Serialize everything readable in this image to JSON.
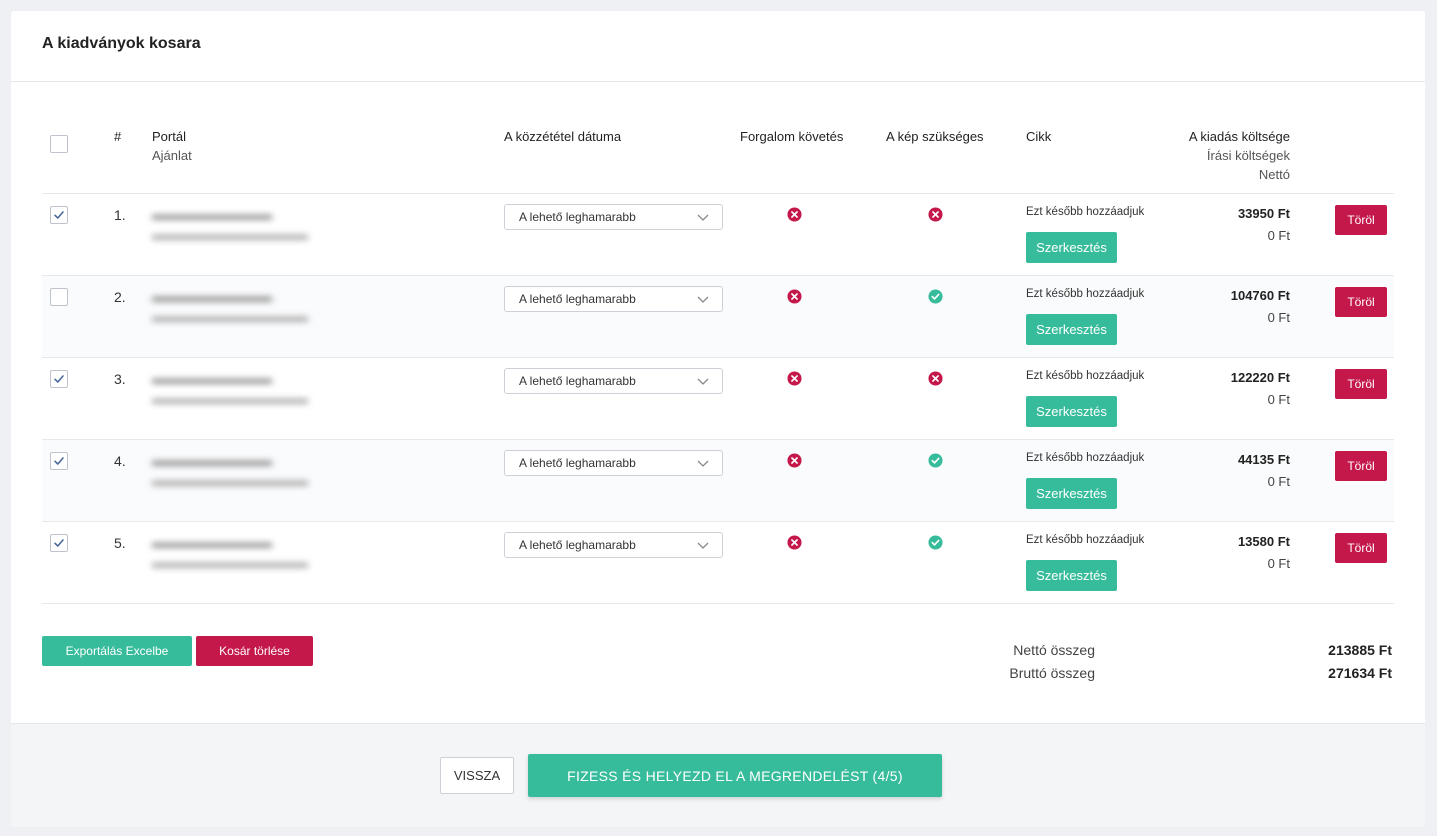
{
  "card": {
    "title": "A kiadványok kosara"
  },
  "table": {
    "headers": {
      "index": "#",
      "portal": "Portál",
      "portal_sub": "Ajánlat",
      "date": "A közzététel dátuma",
      "tracking": "Forgalom követés",
      "image": "A kép szükséges",
      "article": "Cikk",
      "cost": "A kiadás költsége",
      "cost_sub1": "Írási költségek",
      "cost_sub2": "Nettó"
    },
    "rows": [
      {
        "checked": true,
        "num": "1.",
        "date": "A lehető leghamarabb",
        "tracking": "no",
        "image": "no",
        "article_note": "Ezt később hozzáadjuk",
        "edit_label": "Szerkesztés",
        "price": "33950 Ft",
        "writing_cost": "0 Ft",
        "delete_label": "Töröl"
      },
      {
        "checked": false,
        "num": "2.",
        "date": "A lehető leghamarabb",
        "tracking": "no",
        "image": "yes",
        "article_note": "Ezt később hozzáadjuk",
        "edit_label": "Szerkesztés",
        "price": "104760 Ft",
        "writing_cost": "0 Ft",
        "delete_label": "Töröl"
      },
      {
        "checked": true,
        "num": "3.",
        "date": "A lehető leghamarabb",
        "tracking": "no",
        "image": "no",
        "article_note": "Ezt később hozzáadjuk",
        "edit_label": "Szerkesztés",
        "price": "122220 Ft",
        "writing_cost": "0 Ft",
        "delete_label": "Töröl"
      },
      {
        "checked": true,
        "num": "4.",
        "date": "A lehető leghamarabb",
        "tracking": "no",
        "image": "yes",
        "article_note": "Ezt később hozzáadjuk",
        "edit_label": "Szerkesztés",
        "price": "44135 Ft",
        "writing_cost": "0 Ft",
        "delete_label": "Töröl"
      },
      {
        "checked": true,
        "num": "5.",
        "date": "A lehető leghamarabb",
        "tracking": "no",
        "image": "yes",
        "article_note": "Ezt később hozzáadjuk",
        "edit_label": "Szerkesztés",
        "price": "13580 Ft",
        "writing_cost": "0 Ft",
        "delete_label": "Töröl"
      }
    ]
  },
  "actions": {
    "export_label": "Exportálás Excelbe",
    "clear_label": "Kosár törlése"
  },
  "totals": {
    "net_label": "Nettó összeg",
    "net_value": "213885 Ft",
    "gross_label": "Bruttó összeg",
    "gross_value": "271634 Ft"
  },
  "footer": {
    "back_label": "VISSZA",
    "pay_label": "FIZESS ÉS HELYEZD EL A MEGRENDELÉST (4/5)"
  },
  "colors": {
    "accent": "#37bc9b",
    "danger": "#c4174a"
  },
  "icons": {
    "yes": "check-circle-icon",
    "no": "x-circle-icon",
    "dropdown": "chevron-down-icon",
    "checkbox": "checkmark-icon"
  }
}
